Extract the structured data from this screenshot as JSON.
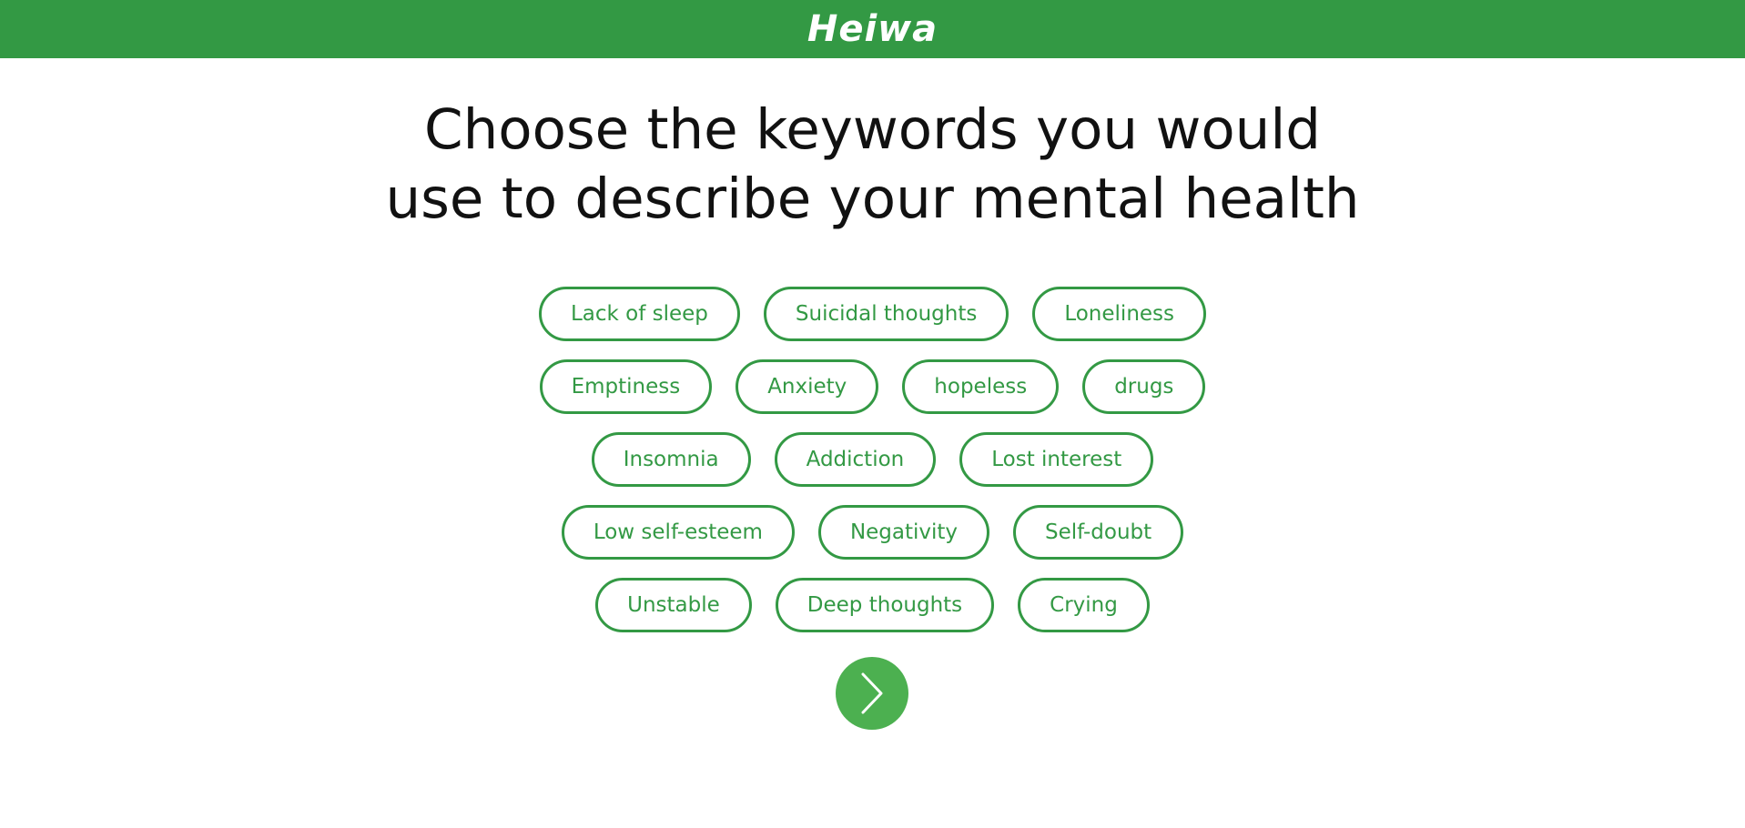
{
  "header": {
    "brand": "Heiwa",
    "background_color": "#339944"
  },
  "main": {
    "heading_line1": "Choose the keywords you would",
    "heading_line2": "use to describe your mental health",
    "keyword_rows": [
      [
        "Lack of sleep",
        "Suicidal thoughts",
        "Loneliness"
      ],
      [
        "Emptiness",
        "Anxiety",
        "hopeless",
        "drugs"
      ],
      [
        "Insomnia",
        "Addiction",
        "Lost interest"
      ],
      [
        "Low self-esteem",
        "Negativity",
        "Self-doubt"
      ],
      [
        "Unstable",
        "Deep thoughts",
        "Crying"
      ]
    ],
    "accent_color": "#339944",
    "next_button": {
      "icon": "chevron-right-icon",
      "color": "#4cb050"
    }
  }
}
